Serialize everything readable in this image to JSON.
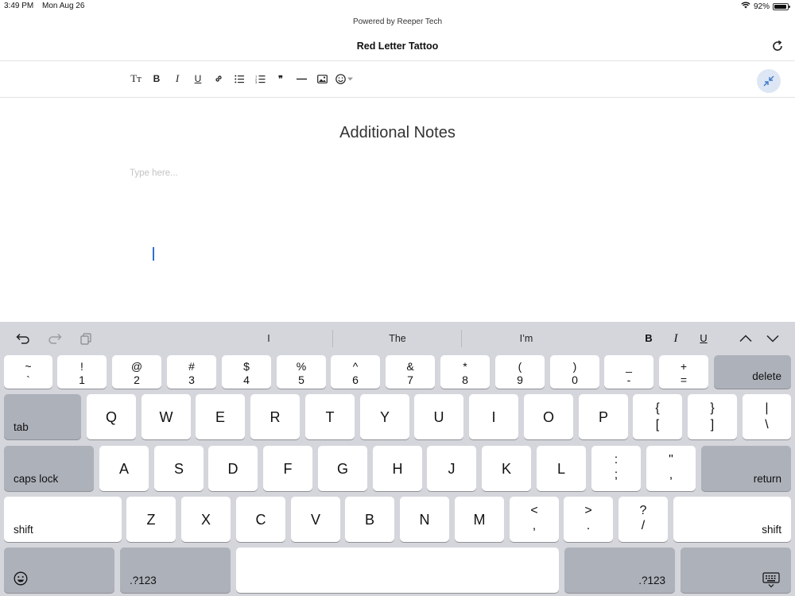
{
  "status_bar": {
    "time": "3:49 PM",
    "date": "Mon Aug 26",
    "battery": "92%",
    "battery_level": 0.92
  },
  "header": {
    "powered_by": "Powered by Reeper Tech",
    "title": "Red Letter Tattoo"
  },
  "editor": {
    "title": "Additional Notes",
    "placeholder": "Type here..."
  },
  "toolbar": {
    "text_style": "Tт",
    "bold": "B",
    "italic": "I",
    "underline": "U",
    "quote": "❞"
  },
  "keyboard": {
    "suggestions": [
      "I",
      "The",
      "I’m"
    ],
    "format": {
      "bold": "B",
      "italic": "I",
      "underline": "U"
    },
    "number_row": [
      {
        "top": "~",
        "bot": "`"
      },
      {
        "top": "!",
        "bot": "1"
      },
      {
        "top": "@",
        "bot": "2"
      },
      {
        "top": "#",
        "bot": "3"
      },
      {
        "top": "$",
        "bot": "4"
      },
      {
        "top": "%",
        "bot": "5"
      },
      {
        "top": "^",
        "bot": "6"
      },
      {
        "top": "&",
        "bot": "7"
      },
      {
        "top": "*",
        "bot": "8"
      },
      {
        "top": "(",
        "bot": "9"
      },
      {
        "top": ")",
        "bot": "0"
      },
      {
        "top": "_",
        "bot": "-"
      },
      {
        "top": "+",
        "bot": "="
      }
    ],
    "delete": "delete",
    "tab": "tab",
    "row_q": [
      "Q",
      "W",
      "E",
      "R",
      "T",
      "Y",
      "U",
      "I",
      "O",
      "P"
    ],
    "row_q_symbols": [
      {
        "top": "{",
        "bot": "["
      },
      {
        "top": "}",
        "bot": "]"
      },
      {
        "top": "|",
        "bot": "\\"
      }
    ],
    "caps_lock": "caps lock",
    "row_a": [
      "A",
      "S",
      "D",
      "F",
      "G",
      "H",
      "J",
      "K",
      "L"
    ],
    "row_a_symbols": [
      {
        "top": ":",
        "bot": ";"
      },
      {
        "top": "\"",
        "bot": ","
      }
    ],
    "return": "return",
    "shift": "shift",
    "row_z": [
      "Z",
      "X",
      "C",
      "V",
      "B",
      "N",
      "M"
    ],
    "row_z_symbols": [
      {
        "top": "<",
        "bot": ","
      },
      {
        "top": ">",
        "bot": "."
      },
      {
        "top": "?",
        "bot": "/"
      }
    ],
    "numbers_key": ".?123"
  }
}
